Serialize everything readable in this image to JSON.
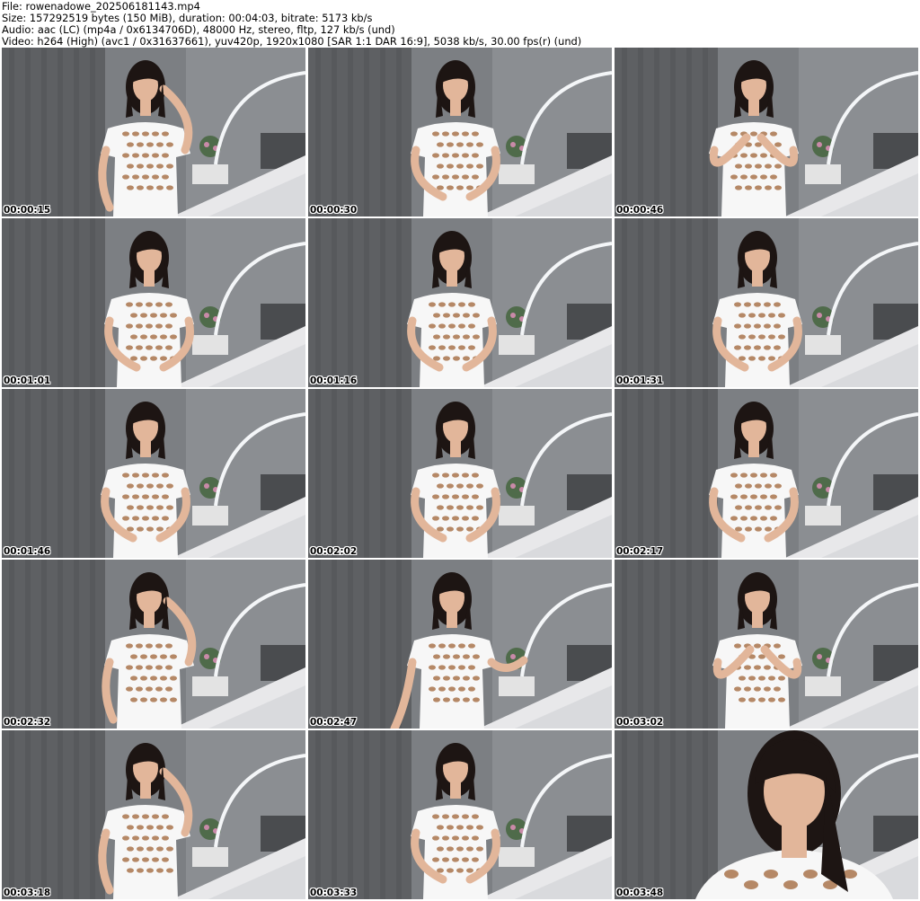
{
  "header": {
    "file_line": "File: rowenadowe_202506181143.mp4",
    "size_line": "Size: 157292519 bytes (150 MiB), duration: 00:04:03, bitrate: 5173 kb/s",
    "audio_line": "Audio: aac (LC) (mp4a / 0x6134706D), 48000 Hz, stereo, fltp, 127 kb/s (und)",
    "video_line": "Video: h264 (High) (avc1 / 0x31637661), yuv420p, 1920x1080 [SAR 1:1 DAR 16:9], 5038 kb/s, 30.00 fps(r) (und)"
  },
  "colors": {
    "curtain": "#5e6063",
    "wall": "#8b8e92",
    "bed": "#e8e8ea",
    "shirt": "#f7f7f7",
    "skin": "#e2b69a",
    "hair": "#1d1513",
    "lamp": "#f4f6f8"
  },
  "frames": [
    {
      "timestamp": "00:00:15",
      "pose": "hand-to-head"
    },
    {
      "timestamp": "00:00:30",
      "pose": "standing"
    },
    {
      "timestamp": "00:00:46",
      "pose": "hands-at-chest"
    },
    {
      "timestamp": "00:01:01",
      "pose": "standing"
    },
    {
      "timestamp": "00:01:16",
      "pose": "standing"
    },
    {
      "timestamp": "00:01:31",
      "pose": "leaning"
    },
    {
      "timestamp": "00:01:46",
      "pose": "standing"
    },
    {
      "timestamp": "00:02:02",
      "pose": "standing"
    },
    {
      "timestamp": "00:02:17",
      "pose": "standing"
    },
    {
      "timestamp": "00:02:32",
      "pose": "hand-to-head"
    },
    {
      "timestamp": "00:02:47",
      "pose": "arms-out"
    },
    {
      "timestamp": "00:03:02",
      "pose": "hands-at-chest"
    },
    {
      "timestamp": "00:03:18",
      "pose": "hand-to-face"
    },
    {
      "timestamp": "00:03:33",
      "pose": "standing"
    },
    {
      "timestamp": "00:03:48",
      "pose": "closeup"
    }
  ]
}
